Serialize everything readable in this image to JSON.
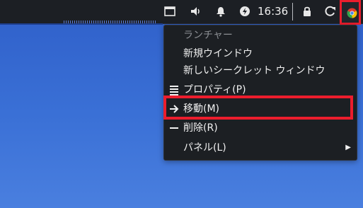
{
  "colors": {
    "panel": "#1c1f24",
    "menu": "#1c1f23",
    "highlight": "#ec1d2d",
    "desktop_top": "#2f5fc9",
    "desktop_bottom": "#4a7fdf",
    "title_text": "#8c8f94",
    "text": "#f1f1f1"
  },
  "tray": {
    "clock": "16:36",
    "icons": [
      "window-icon",
      "speaker-icon",
      "bell-icon",
      "battery-icon",
      "lock-icon",
      "refresh-icon"
    ]
  },
  "menu": {
    "title": "ランチャー",
    "items": [
      {
        "label": "新規ウインドウ",
        "icon": ""
      },
      {
        "label": "新しいシークレット ウィンドウ",
        "icon": ""
      },
      {
        "label": "プロパティ(P)",
        "icon": "list-icon"
      },
      {
        "label": "移動(M)",
        "icon": "arrow-icon"
      },
      {
        "label": "削除(R)",
        "icon": "minus-icon"
      },
      {
        "label": "パネル(L)",
        "icon": "",
        "submenu": true
      }
    ]
  }
}
